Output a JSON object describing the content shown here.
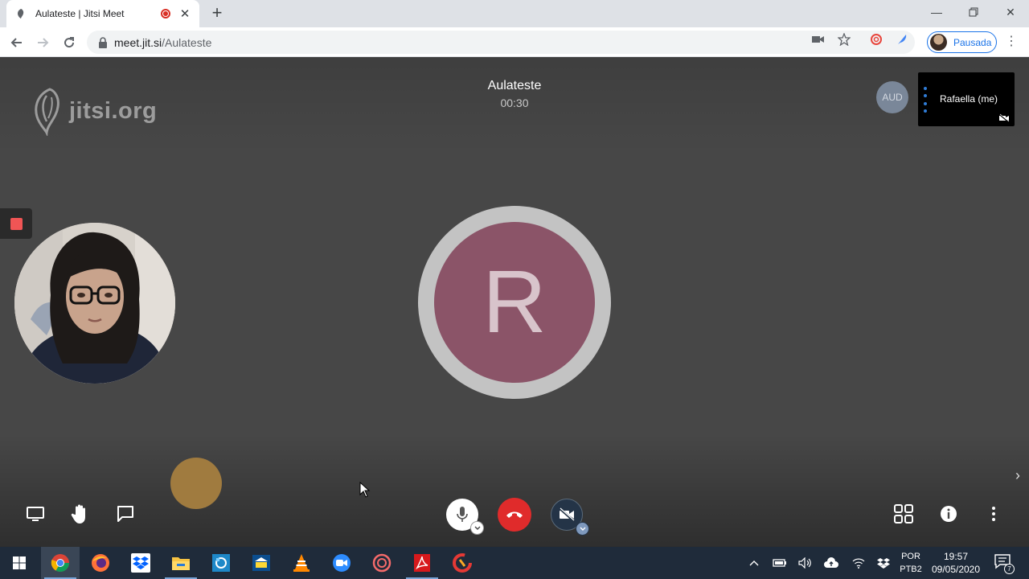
{
  "browser": {
    "tab_title": "Aulateste | Jitsi Meet",
    "url_host": "meet.jit.si",
    "url_path": "/Aulateste",
    "profile_label": "Pausada"
  },
  "meeting": {
    "watermark": "jitsi.org",
    "subject": "Aulateste",
    "timer": "00:30",
    "audio_badge": "AUD",
    "local_name": "Rafaella (me)",
    "avatar_letter": "R",
    "avatar_color": "#8b5468",
    "hangup_color": "#e02b2b"
  },
  "toolbox": {
    "left": [
      "screen-share-icon",
      "raise-hand-icon",
      "chat-icon"
    ],
    "center": [
      "microphone-icon",
      "hangup-icon",
      "camera-off-icon"
    ],
    "right": [
      "tile-view-icon",
      "info-icon",
      "more-options-icon"
    ]
  },
  "taskbar": {
    "apps": [
      "windows-start-icon",
      "chrome-icon",
      "firefox-icon",
      "dropbox-icon",
      "file-explorer-icon",
      "network-app-icon",
      "bank-app-icon",
      "vlc-icon",
      "zoom-icon",
      "camera-app-icon",
      "acrobat-icon",
      "ccleaner-icon"
    ],
    "lang_top": "POR",
    "lang_bottom": "PTB2",
    "time": "19:57",
    "date": "09/05/2020",
    "notification_count": "7"
  }
}
